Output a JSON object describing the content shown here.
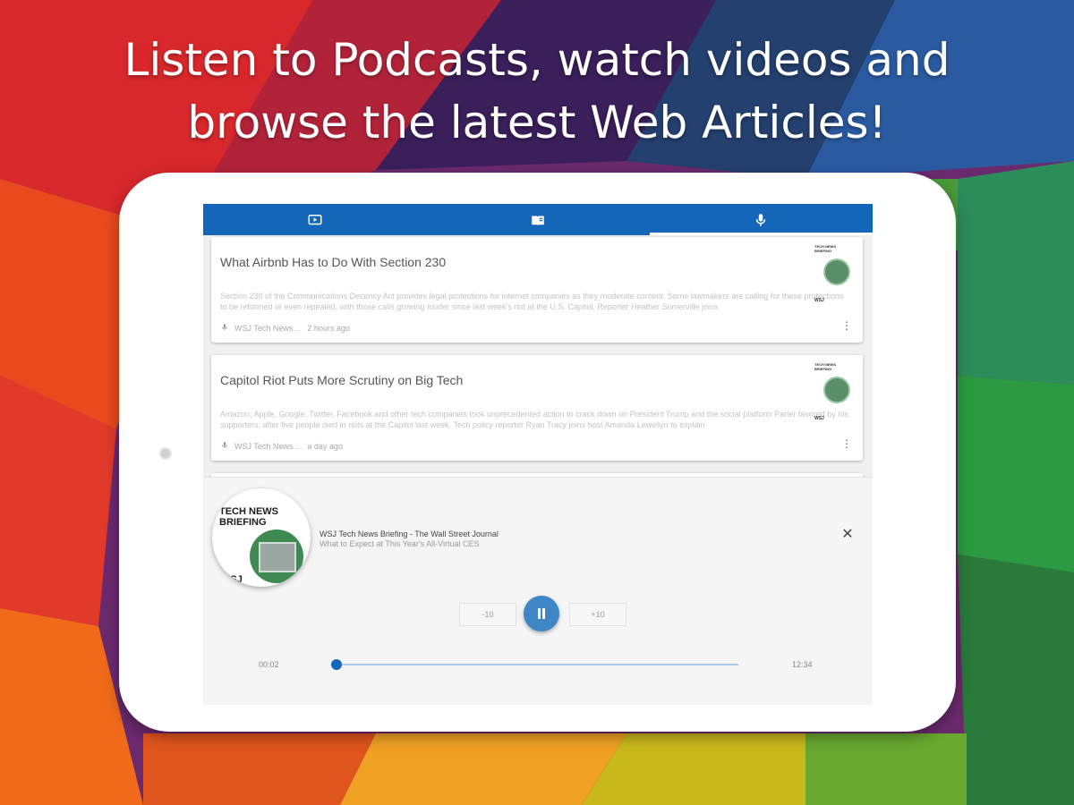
{
  "headline": {
    "line1": "Listen to Podcasts, watch videos and",
    "line2": "browse the latest Web Articles!"
  },
  "tabs": [
    {
      "icon": "video-icon",
      "active": false
    },
    {
      "icon": "article-icon",
      "active": false
    },
    {
      "icon": "microphone-icon",
      "active": true
    }
  ],
  "episodes": [
    {
      "title": "What Airbnb Has to Do With Section 230",
      "description": "Section 230 of the Communications Decency Act provides legal protections for internet companies as they moderate content. Some lawmakers are calling for these protections to be reformed or even repealed, with those calls growing louder since last week's riot at the U.S. Capitol. Reporter Heather Somerville joins",
      "source": "WSJ Tech News ...",
      "time": "2 hours ago",
      "thumb_label": "TECH NEWS BRIEFING",
      "thumb_brand": "WSJ"
    },
    {
      "title": "Capitol Riot Puts More Scrutiny on Big Tech",
      "description": "Amazon, Apple, Google, Twitter, Facebook and other tech companies took unprecedented action to crack down on President Trump and the social platform Parler favored by his supporters, after five people died in riots at the Capitol last week. Tech policy reporter Ryan Tracy joins host Amanda Lewellyn to explain",
      "source": "WSJ Tech News ...",
      "time": "a day ago",
      "thumb_label": "TECH NEWS BRIEFING",
      "thumb_brand": "WSJ"
    }
  ],
  "player": {
    "art_label": "TECH NEWS BRIEFING",
    "art_brand": "WSJ",
    "title": "WSJ Tech News Briefing - The Wall Street Journal",
    "subtitle": "What to Expect at This Year's All-Virtual CES",
    "skip_back": "-10",
    "skip_forward": "+10",
    "elapsed": "00:02",
    "total": "12:34",
    "progress": 0.003
  },
  "colors": {
    "accent": "#1466b8",
    "pause": "#3f86c6"
  }
}
